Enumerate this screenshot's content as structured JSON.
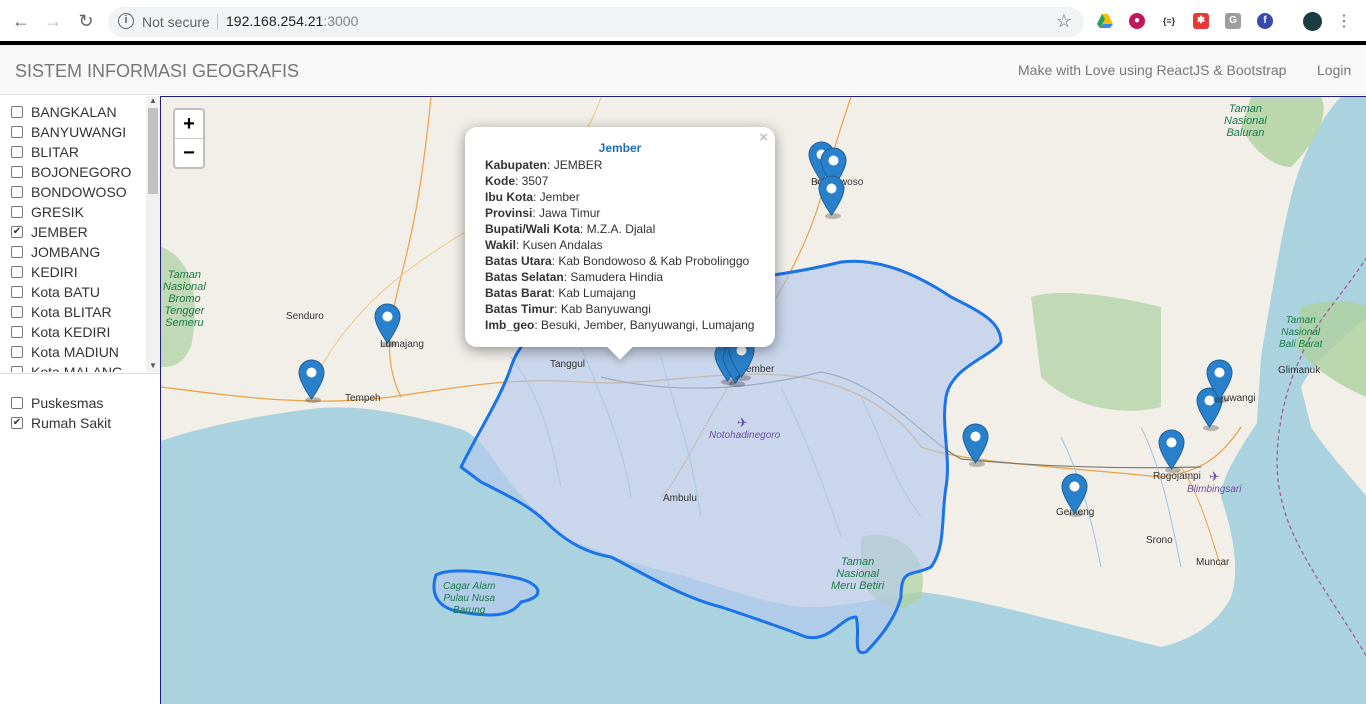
{
  "browser": {
    "not_secure": "Not secure",
    "url_host": "192.168.254.21",
    "url_port": ":3000"
  },
  "navbar": {
    "brand": "SISTEM INFORMASI GEOGRAFIS",
    "made_with": "Make with Love using ReactJS & Bootstrap",
    "login": "Login"
  },
  "sidebar": {
    "regions": [
      {
        "label": "BANGKALAN",
        "checked": false
      },
      {
        "label": "BANYUWANGI",
        "checked": false
      },
      {
        "label": "BLITAR",
        "checked": false
      },
      {
        "label": "BOJONEGORO",
        "checked": false
      },
      {
        "label": "BONDOWOSO",
        "checked": false
      },
      {
        "label": "GRESIK",
        "checked": false
      },
      {
        "label": "JEMBER",
        "checked": true
      },
      {
        "label": "JOMBANG",
        "checked": false
      },
      {
        "label": "KEDIRI",
        "checked": false
      },
      {
        "label": "Kota BATU",
        "checked": false
      },
      {
        "label": "Kota BLITAR",
        "checked": false
      },
      {
        "label": "Kota KEDIRI",
        "checked": false
      },
      {
        "label": "Kota MADIUN",
        "checked": false
      },
      {
        "label": "Kota MALANG",
        "checked": false
      }
    ],
    "facilities": [
      {
        "label": "Puskesmas",
        "checked": false
      },
      {
        "label": "Rumah Sakit",
        "checked": true
      }
    ]
  },
  "map": {
    "zoom_in": "+",
    "zoom_out": "−",
    "popup": {
      "title": "Jember",
      "close": "×",
      "rows": [
        {
          "key": "Kabupaten",
          "value": "JEMBER"
        },
        {
          "key": "Kode",
          "value": "3507"
        },
        {
          "key": "Ibu Kota",
          "value": "Jember"
        },
        {
          "key": "Provinsi",
          "value": "Jawa Timur"
        },
        {
          "key": "Bupati/Wali Kota",
          "value": "M.Z.A. Djalal"
        },
        {
          "key": "Wakil",
          "value": "Kusen Andalas"
        },
        {
          "key": "Batas Utara",
          "value": "Kab Bondowoso & Kab Probolinggo"
        },
        {
          "key": "Batas Selatan",
          "value": "Samudera Hindia"
        },
        {
          "key": "Batas Barat",
          "value": "Kab Lumajang"
        },
        {
          "key": "Batas Timur",
          "value": "Kab Banyuwangi"
        },
        {
          "key": "Imb_geo",
          "value": "Besuki, Jember, Banyuwangi, Lumajang"
        }
      ]
    },
    "labels": {
      "senduro": "Senduro",
      "lumajang": "Lumajang",
      "tempeh": "Tempeh",
      "tanggul": "Tanggul",
      "jember": "Jember",
      "ambulu": "Ambulu",
      "bondowoso": "Bondowoso",
      "genteng": "Genteng",
      "rogojampi": "Rogojampi",
      "srono": "Srono",
      "muncar": "Muncar",
      "glimanuk": "Glimanuk",
      "banyuwangi": "Banyuwangi"
    },
    "parks": {
      "bromo": [
        "Taman",
        "Nasional",
        "Bromo",
        "Tengger",
        "Semeru"
      ],
      "baluran": [
        "Taman",
        "Nasional",
        "Baluran"
      ],
      "bali_barat": [
        "Taman",
        "Nasional",
        "Bali Barat"
      ],
      "meru_betiri": [
        "Taman",
        "Nasional",
        "Meru Betiri"
      ],
      "nusa_barung": [
        "Cagar Alam",
        "Pulau Nusa",
        "Barung"
      ]
    },
    "airports": {
      "notohadinegoro": "Notohadinegoro",
      "blimbingsari": "Blimbingsari"
    },
    "colors": {
      "land": "#f2efe9",
      "sea": "#aad3df",
      "region_fill": "#b3c8ec",
      "region_stroke": "#1a73e8",
      "marker": "#2a81cb",
      "forest": "#add19e"
    }
  }
}
